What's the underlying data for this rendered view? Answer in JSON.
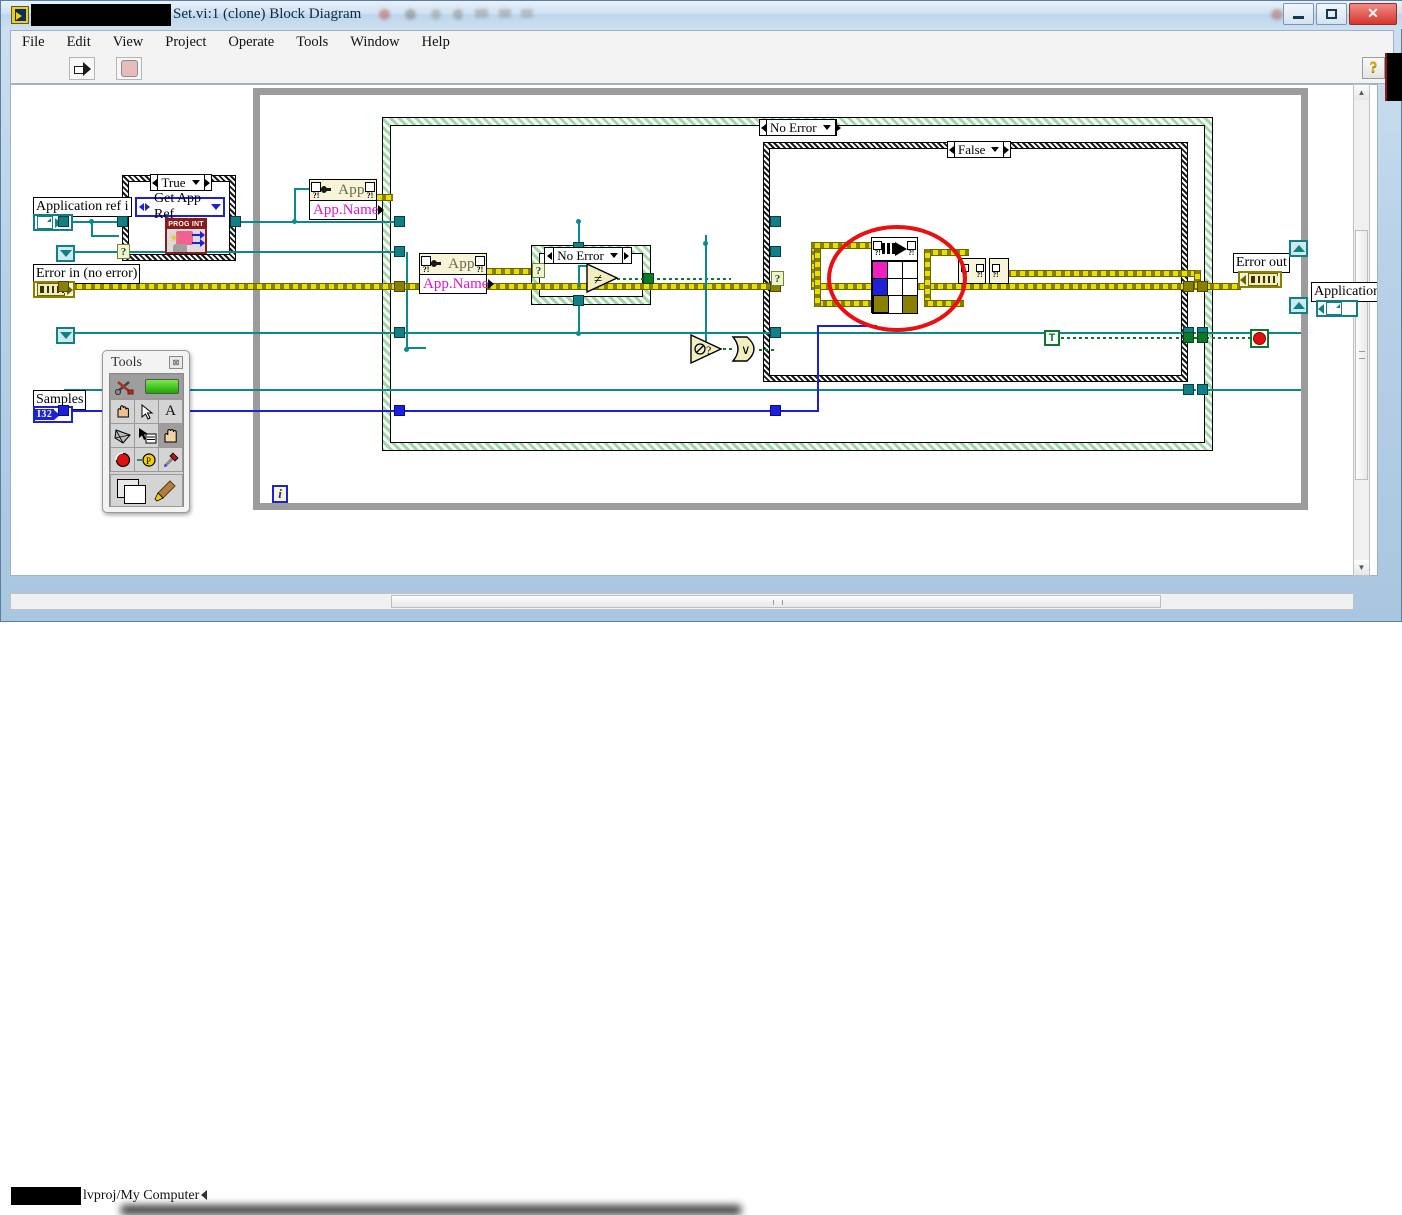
{
  "window": {
    "title": "Set.vi:1 (clone) Block Diagram",
    "redacted_prefix": "",
    "minimize_label": "",
    "maximize_label": "",
    "close_label": "✕"
  },
  "menubar": {
    "items": [
      {
        "label": "File"
      },
      {
        "label": "Edit"
      },
      {
        "label": "View"
      },
      {
        "label": "Project"
      },
      {
        "label": "Operate"
      },
      {
        "label": "Tools"
      },
      {
        "label": "Window"
      },
      {
        "label": "Help"
      }
    ]
  },
  "toolbar": {
    "run_icon": "run-arrow-icon",
    "abort_icon": "abort-stop-icon",
    "help_label": "?"
  },
  "statusbar": {
    "target": "lvproj/My Computer",
    "scroll_arrow": "left-arrow-icon"
  },
  "diagram": {
    "controls": [
      {
        "name": "application-ref-in",
        "label": "Application ref i",
        "type": "refnum"
      },
      {
        "name": "error-in",
        "label": "Error in (no error)",
        "type": "error-cluster"
      },
      {
        "name": "samples",
        "label": "Samples",
        "type": "I32",
        "datatype_label": "I32"
      }
    ],
    "indicators": [
      {
        "name": "error-out",
        "label": "Error out",
        "type": "error-cluster"
      },
      {
        "name": "application-out",
        "label": "Application",
        "type": "refnum"
      }
    ],
    "structures": [
      {
        "name": "true-case",
        "selector": "True"
      },
      {
        "name": "no-error-case-outer",
        "selector": "No Error"
      },
      {
        "name": "no-error-case-inner",
        "selector": "No Error"
      },
      {
        "name": "false-case",
        "selector": "False"
      }
    ],
    "nodes": [
      {
        "name": "get-app-ref-subvi",
        "label": "Get App Ref",
        "icon_caption": "PROG INT"
      },
      {
        "name": "app-property-node-top",
        "class_label": "App",
        "property": "App.Name"
      },
      {
        "name": "app-property-node-mid",
        "class_label": "App",
        "property": "App.Name"
      },
      {
        "name": "not-equal-primitive",
        "glyph": "≠"
      },
      {
        "name": "not-primitive",
        "glyph": "∅?"
      },
      {
        "name": "or-primitive",
        "glyph": "∨"
      },
      {
        "name": "open-app-ref-subvi",
        "glyph": "arrow-table-icon"
      },
      {
        "name": "boolean-tunnel",
        "glyph": "?"
      },
      {
        "name": "true-constant",
        "glyph": "T"
      },
      {
        "name": "stop-button-constant",
        "glyph": "stop-icon"
      },
      {
        "name": "loop-iteration-terminal",
        "glyph": "i"
      }
    ],
    "colors": {
      "refnum_wire": "#0a8a8a",
      "integer_wire": "#1c20d8",
      "error_wire": "#e8e000",
      "boolean_wire": "#0a7a28",
      "annotation": "#e81010",
      "property_name": "#e014c8"
    }
  },
  "tools_palette": {
    "title": "Tools",
    "close_label": "⊠",
    "tools": [
      {
        "name": "automatic-tool-selection",
        "glyph": "wrench-screwdriver-icon"
      },
      {
        "name": "automatic-indicator-led",
        "glyph": "green-led"
      },
      {
        "name": "operate-value-tool",
        "glyph": "✋"
      },
      {
        "name": "position-size-select-tool",
        "glyph": "↖"
      },
      {
        "name": "edit-text-tool",
        "glyph": "A"
      },
      {
        "name": "connect-wire-tool",
        "glyph": "spool-icon"
      },
      {
        "name": "object-shortcut-menu-tool",
        "glyph": "menu-arrow-icon"
      },
      {
        "name": "scroll-window-tool",
        "glyph": "🖐"
      },
      {
        "name": "set-clear-breakpoint-tool",
        "glyph": "breakpoint-icon"
      },
      {
        "name": "probe-data-tool",
        "glyph": "probe-icon"
      },
      {
        "name": "get-set-color-tool",
        "glyph": "dropper-icon"
      },
      {
        "name": "color-squares",
        "glyph": "color-squares-icon"
      },
      {
        "name": "paint-brush",
        "glyph": "brush-icon"
      }
    ]
  }
}
